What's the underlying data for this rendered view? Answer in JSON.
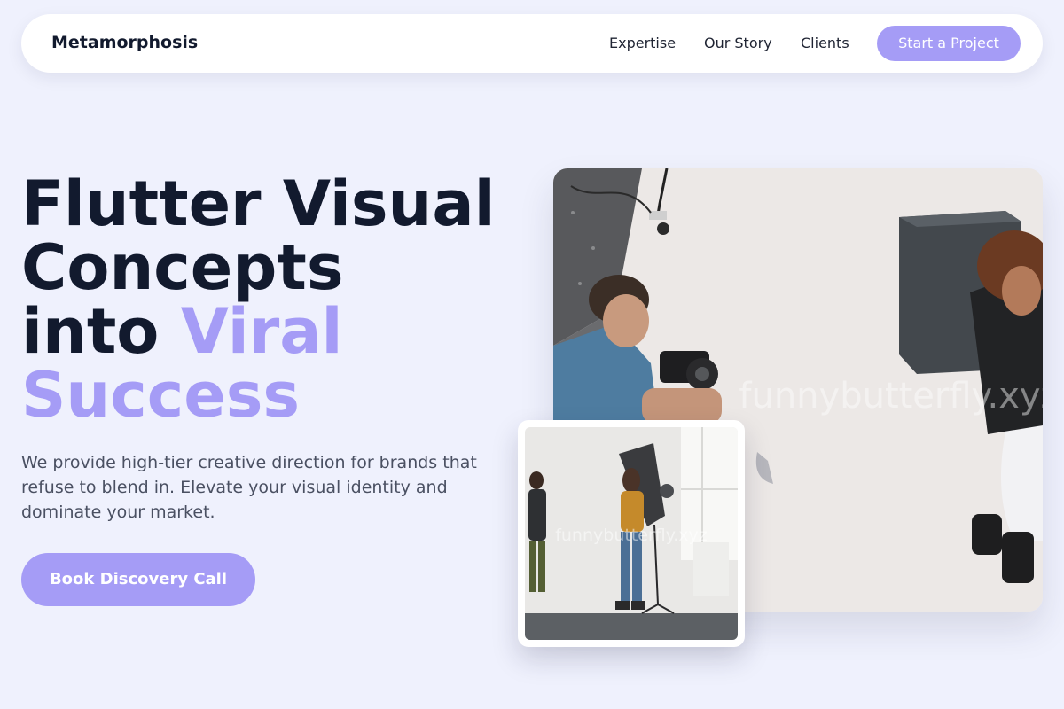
{
  "nav": {
    "brand": "Metamorphosis",
    "links": [
      "Expertise",
      "Our Story",
      "Clients"
    ],
    "cta_label": "Start a Project"
  },
  "hero": {
    "headline_line1": "Flutter Visual",
    "headline_line2": "Concepts",
    "headline_line3_plain": "into ",
    "headline_line3_accent": "Viral",
    "headline_line4_accent": "Success",
    "subtext": "We provide high-tier creative direction for brands that refuse to blend in. Elevate your visual identity and dominate your market.",
    "button_label": "Book Discovery Call"
  },
  "images": {
    "main_watermark": "funnybutterfly.xyz",
    "inset_watermark": "funnybutterfly.xyz"
  },
  "colors": {
    "background": "#eff1fd",
    "accent": "#a59cf6",
    "text_dark": "#121a2e",
    "text_muted": "#4a5062"
  }
}
